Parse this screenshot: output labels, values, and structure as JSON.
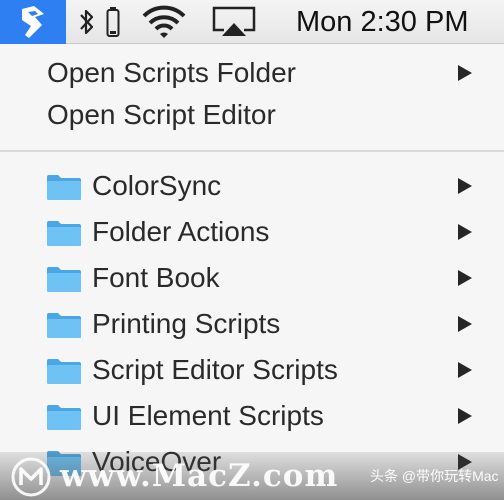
{
  "menubar": {
    "script_menu_icon": "applescript-icon",
    "status_icons": [
      "bluetooth-icon",
      "battery-icon",
      "wifi-icon",
      "airplay-icon"
    ],
    "clock": "Mon 2:30 PM",
    "accent_color": "#2e80f2"
  },
  "menu": {
    "top_items": [
      {
        "label": "Open Scripts Folder",
        "has_submenu": true
      },
      {
        "label": "Open Script Editor",
        "has_submenu": false
      }
    ],
    "folder_items": [
      {
        "label": "ColorSync",
        "icon": "folder-icon",
        "has_submenu": true
      },
      {
        "label": "Folder Actions",
        "icon": "folder-icon",
        "has_submenu": true
      },
      {
        "label": "Font Book",
        "icon": "folder-icon",
        "has_submenu": true
      },
      {
        "label": "Printing Scripts",
        "icon": "folder-icon",
        "has_submenu": true
      },
      {
        "label": "Script Editor Scripts",
        "icon": "folder-icon",
        "has_submenu": true
      },
      {
        "label": "UI Element Scripts",
        "icon": "folder-icon",
        "has_submenu": true
      },
      {
        "label": "VoiceOver",
        "icon": "folder-icon",
        "has_submenu": true
      }
    ],
    "folder_color": "#5ab8f0"
  },
  "watermark": {
    "brand": "www.MacZ.com",
    "credit": "头条 @带你玩转Mac"
  }
}
